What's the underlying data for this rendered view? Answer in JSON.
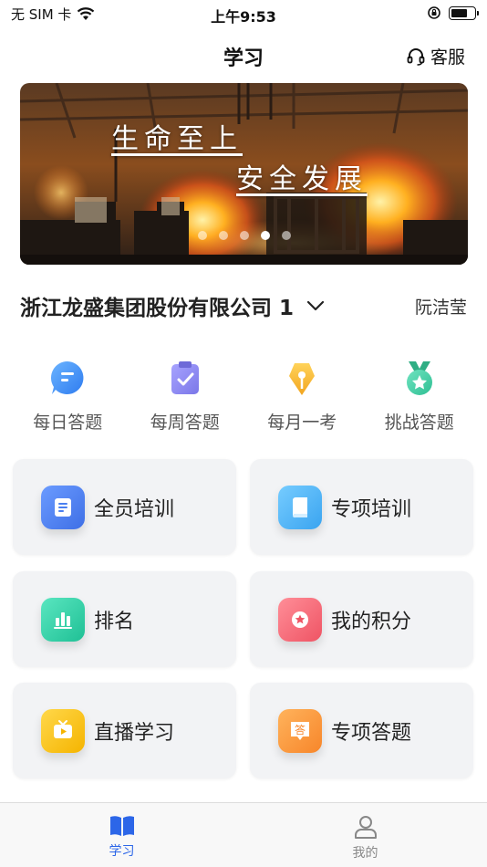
{
  "status_bar": {
    "carrier": "无 SIM 卡",
    "time": "上午9:53"
  },
  "nav": {
    "title": "学习",
    "service_label": "客服"
  },
  "banner": {
    "slogan_line1": "生命至上",
    "slogan_line2": "安全发展",
    "dot_count": 5,
    "active_dot": 4
  },
  "company": {
    "name": "浙江龙盛集团股份有限公司 1",
    "user": "阮洁莹"
  },
  "quick_actions": [
    {
      "label": "每日答题",
      "icon": "chat-bubble-icon",
      "color": "#3d8ef5"
    },
    {
      "label": "每周答题",
      "icon": "clipboard-check-icon",
      "color": "#8f8cf0"
    },
    {
      "label": "每月一考",
      "icon": "pen-nib-icon",
      "color": "#f5b32a"
    },
    {
      "label": "挑战答题",
      "icon": "medal-icon",
      "color": "#3ec9a0"
    }
  ],
  "cards": [
    {
      "label": "全员培训",
      "icon": "document-icon",
      "color": "#4a7ff0"
    },
    {
      "label": "专项培训",
      "icon": "book-icon",
      "color": "#4ab4f5"
    },
    {
      "label": "排名",
      "icon": "bar-chart-icon",
      "color": "#2fcfa6"
    },
    {
      "label": "我的积分",
      "icon": "star-badge-icon",
      "color": "#f56b78"
    },
    {
      "label": "直播学习",
      "icon": "tv-play-icon",
      "color": "#f7c317"
    },
    {
      "label": "专项答题",
      "icon": "answer-badge-icon",
      "color": "#fb9a3a",
      "glyph": "答"
    }
  ],
  "tabs": [
    {
      "label": "学习",
      "icon": "open-book-icon",
      "active": true
    },
    {
      "label": "我的",
      "icon": "person-icon",
      "active": false
    }
  ],
  "colors": {
    "accent": "#2c66e8"
  }
}
